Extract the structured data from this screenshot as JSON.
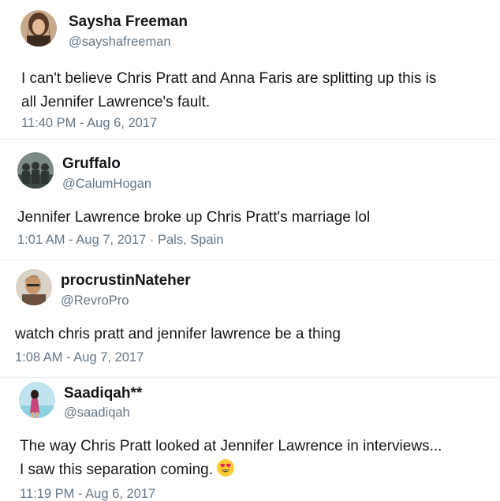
{
  "tweets": [
    {
      "name": "Saysha Freeman",
      "handle": "@sayshafreeman",
      "text_lines": [
        "I can't believe Chris Pratt and Anna Faris are splitting up this is",
        "all Jennifer Lawrence's fault."
      ],
      "timestamp": "11:40 PM - Aug 6, 2017",
      "location": ""
    },
    {
      "name": "Gruffalo",
      "handle": "@CalumHogan",
      "text_lines": [
        "Jennifer Lawrence broke up Chris Pratt's marriage lol"
      ],
      "timestamp": "1:01 AM - Aug 7, 2017",
      "location": "Pals, Spain"
    },
    {
      "name": "procrustinNateher",
      "handle": "@RevroPro",
      "text_lines": [
        "watch chris pratt and jennifer lawrence be a thing"
      ],
      "timestamp": "1:08 AM - Aug 7, 2017",
      "location": ""
    },
    {
      "name": "Saadiqah**",
      "handle": "@saadiqah",
      "text_lines": [
        "The way Chris Pratt looked at Jennifer Lawrence in interviews...",
        "I saw this separation coming."
      ],
      "timestamp": "11:19 PM - Aug 6, 2017",
      "location": "",
      "emoji": "heart-eyes-emoji"
    }
  ],
  "meta_separator": " · ",
  "colors": {
    "text": "#14171a",
    "secondary": "#657786",
    "divider": "#e6ecf0"
  }
}
